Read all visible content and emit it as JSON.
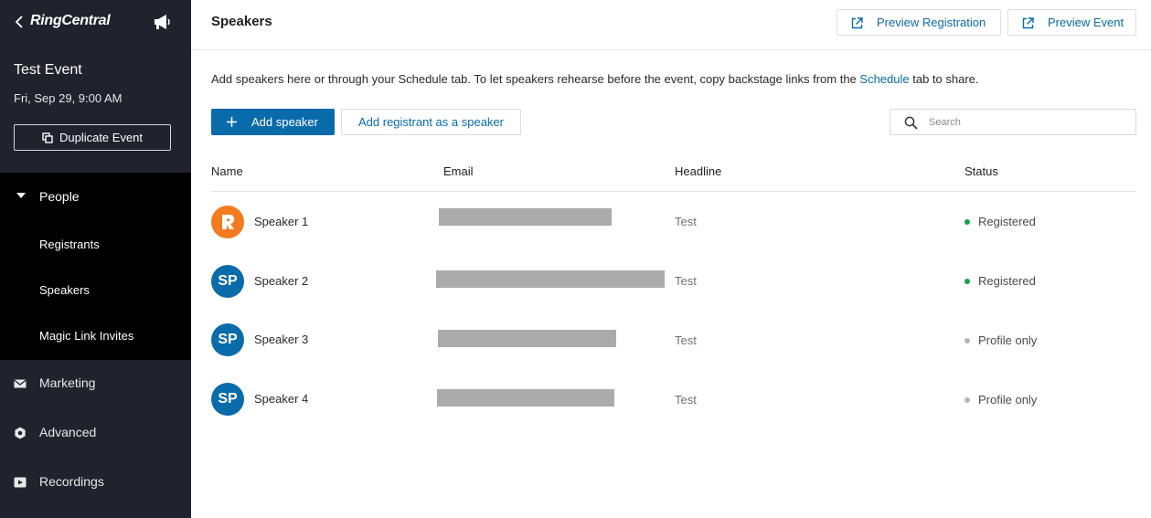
{
  "sidebar": {
    "logo_text": "RingCentral",
    "event_title": "Test Event",
    "event_date": "Fri, Sep 29, 9:00 AM",
    "duplicate_label": "Duplicate Event",
    "people_label": "People",
    "people_items": [
      "Registrants",
      "Speakers",
      "Magic Link Invites"
    ],
    "nav_items": [
      {
        "label": "Marketing",
        "icon": "envelope-icon"
      },
      {
        "label": "Advanced",
        "icon": "hexagon-gear-icon"
      },
      {
        "label": "Recordings",
        "icon": "recording-icon"
      }
    ]
  },
  "header": {
    "title": "Speakers",
    "preview_registration": "Preview Registration",
    "preview_event": "Preview Event"
  },
  "intro": {
    "before": "Add speakers here or through your Schedule tab. To let speakers rehearse before the event, copy backstage links from the ",
    "link": "Schedule",
    "after": " tab to share."
  },
  "actions": {
    "add_speaker": "Add speaker",
    "add_registrant": "Add registrant as a speaker",
    "search_placeholder": "Search"
  },
  "table": {
    "columns": [
      "Name",
      "Email",
      "Headline",
      "Status"
    ],
    "rows": [
      {
        "avatar": "R",
        "name": "Speaker 1",
        "headline": "Test",
        "status": "Registered"
      },
      {
        "avatar": "SP",
        "name": "Speaker 2",
        "headline": "Test",
        "status": "Registered"
      },
      {
        "avatar": "SP",
        "name": "Speaker 3",
        "headline": "Test",
        "status": "Profile only"
      },
      {
        "avatar": "SP",
        "name": "Speaker 4",
        "headline": "Test",
        "status": "Profile only"
      }
    ]
  },
  "colors": {
    "sidebar_bg": "#20232d",
    "accent": "#0a6bab",
    "registered": "#1a9e4b",
    "profile_only": "#b5b5b5",
    "brand_orange": "#f47a20"
  }
}
